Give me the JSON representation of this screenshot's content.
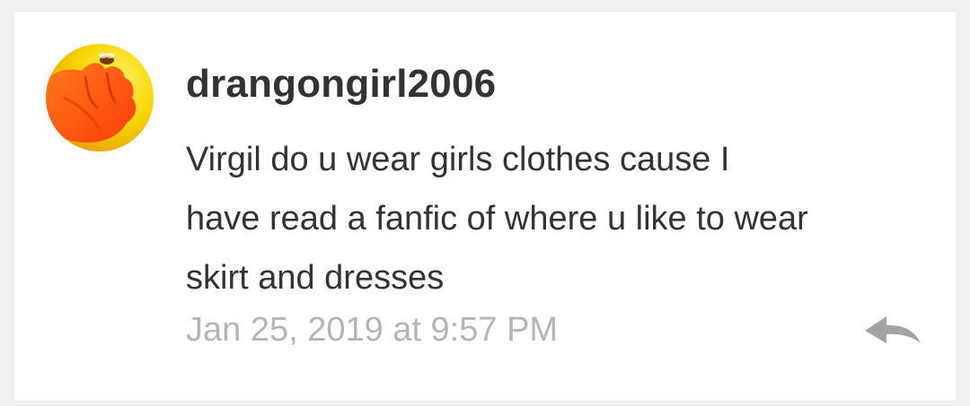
{
  "comment": {
    "username": "drangongirl2006",
    "message_lines": [
      "Virgil do u wear girls clothes cause I",
      "have read a fanfic of where u like to wear",
      "skirt and dresses"
    ],
    "timestamp": "Jan 25, 2019 at 9:57 PM",
    "avatar_icon": "user-avatar-hand-with-bee",
    "reply_icon": "reply-arrow-icon"
  },
  "colors": {
    "card_background": "#ffffff",
    "page_background": "#f0f0f0",
    "text_primary": "#333333",
    "text_muted": "#b5b5b5",
    "icon_muted": "#a3a3a3",
    "avatar_yellow": "#f5c800",
    "avatar_orange": "#ff5a12"
  }
}
